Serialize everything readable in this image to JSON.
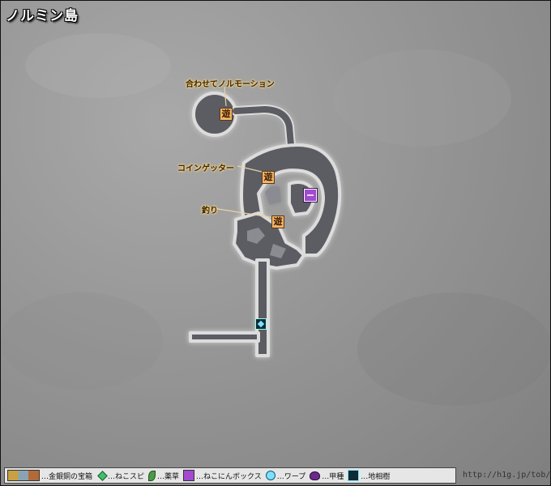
{
  "map": {
    "title": "ノルミン島",
    "callouts": [
      {
        "id": "norumin-motion",
        "label": "合わせてノルモーション",
        "marker": "遊"
      },
      {
        "id": "coin-getter",
        "label": "コインゲッター",
        "marker": "遊"
      },
      {
        "id": "fishing",
        "label": "釣り",
        "marker": "遊"
      }
    ],
    "marker_glyph": "遊"
  },
  "legend": {
    "items": [
      {
        "label": "…金銀銅の宝箱",
        "icon": "treasure-chests-icon"
      },
      {
        "label": "…ねこスピ",
        "icon": "green-diamond-icon"
      },
      {
        "label": "…薬草",
        "icon": "herb-leaf-icon"
      },
      {
        "label": "…ねこにんボックス",
        "icon": "purple-box-icon"
      },
      {
        "label": "…ワープ",
        "icon": "warp-circle-icon"
      },
      {
        "label": "…甲種",
        "icon": "beetle-icon"
      },
      {
        "label": "…地相樹",
        "icon": "earth-tree-icon"
      }
    ]
  },
  "footer": {
    "url": "http://h1g.jp/tob/"
  },
  "colors": {
    "floor": "#5b5b63",
    "floor_glow": "#d8d8d8",
    "background": "#949494",
    "callout_text": "#3a2608",
    "marker_orange": "#f3b46a",
    "chest_purple": "#a24ad0",
    "warp_cyan": "#7ee0ff"
  }
}
